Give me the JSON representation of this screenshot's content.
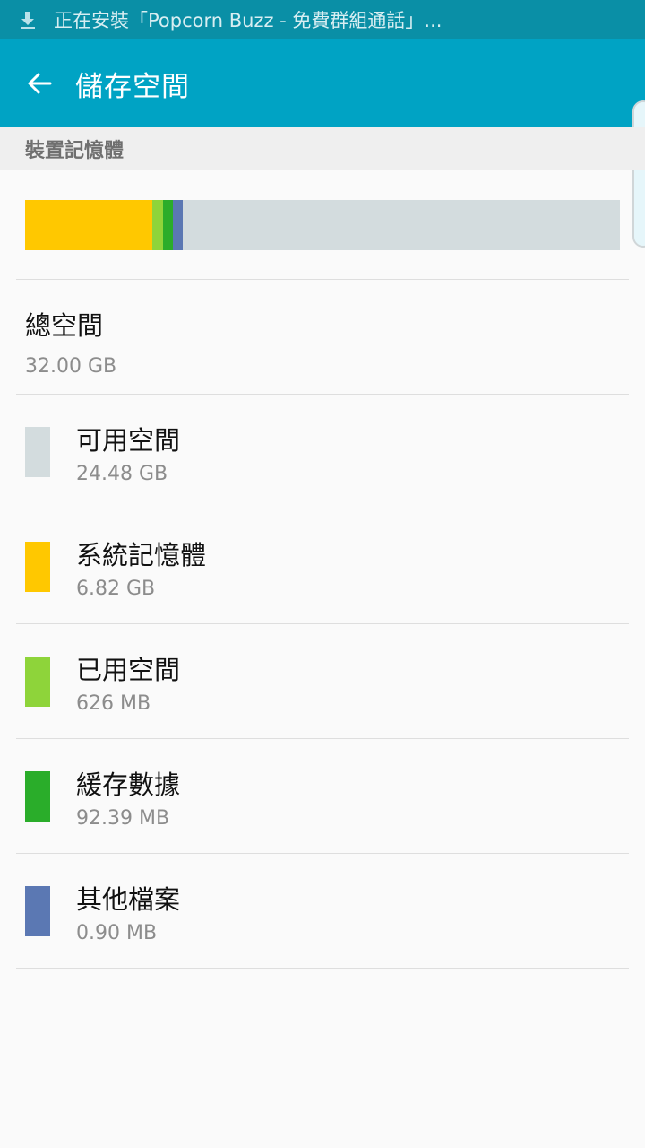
{
  "status_bar": {
    "text": "正在安裝「Popcorn Buzz - 免費群組通話」...",
    "icon": "download-icon"
  },
  "app_bar": {
    "title": "儲存空間",
    "back_icon": "back-arrow-icon",
    "background": "#00a3c4"
  },
  "section": {
    "header": "裝置記憶體"
  },
  "usage_bar": {
    "total_gb": 32.0,
    "segments": [
      {
        "name": "系統記憶體",
        "gb": 6.82,
        "color": "#ffc800"
      },
      {
        "name": "已用空間",
        "gb": 0.611,
        "color": "#8ed43a"
      },
      {
        "name": "緩存數據",
        "gb": 0.0902,
        "color": "#2aad2a"
      },
      {
        "name": "其他檔案",
        "gb": 0.00088,
        "color": "#5b78b3"
      }
    ],
    "background": "#d3dcde"
  },
  "total": {
    "label": "總空間",
    "value": "32.00 GB"
  },
  "items": [
    {
      "label": "可用空間",
      "value": "24.48 GB",
      "color": "#d3dcde"
    },
    {
      "label": "系統記憶體",
      "value": "6.82 GB",
      "color": "#ffc800"
    },
    {
      "label": "已用空間",
      "value": "626 MB",
      "color": "#8ed43a"
    },
    {
      "label": "緩存數據",
      "value": "92.39 MB",
      "color": "#2aad2a"
    },
    {
      "label": "其他檔案",
      "value": "0.90 MB",
      "color": "#5b78b3"
    }
  ]
}
